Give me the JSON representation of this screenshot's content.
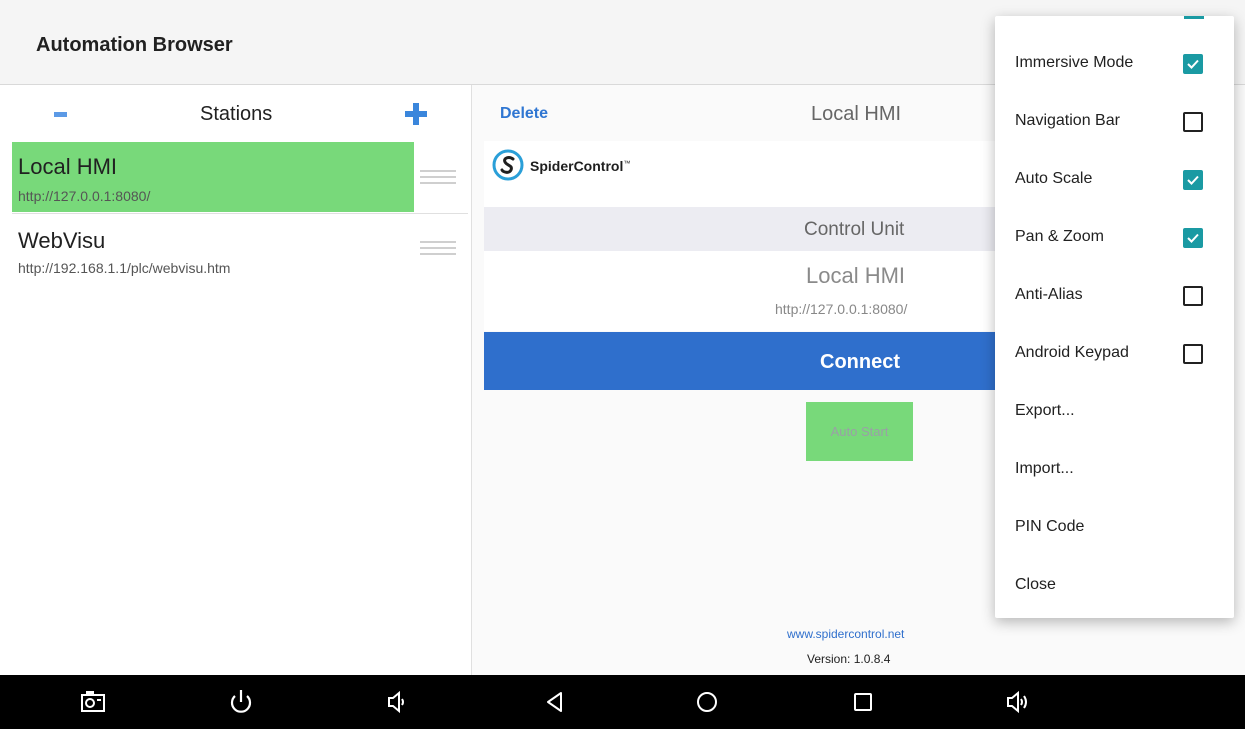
{
  "app": {
    "title": "Automation Browser"
  },
  "stations": {
    "header": {
      "title": "Stations",
      "minus_icon": "minus-icon",
      "plus_icon": "plus-icon"
    },
    "items": [
      {
        "name": "Local HMI",
        "url": "http://127.0.0.1:8080/",
        "selected": true
      },
      {
        "name": "WebVisu",
        "url": "http://192.168.1.1/plc/webvisu.htm",
        "selected": false
      }
    ]
  },
  "detail": {
    "delete_label": "Delete",
    "title": "Local HMI",
    "logo_text": "SpiderControl",
    "logo_tm": "™",
    "control_unit_label": "Control Unit",
    "hmi_name": "Local HMI",
    "hmi_url": "http://127.0.0.1:8080/",
    "connect_label": "Connect",
    "auto_start_label": "Auto Start",
    "website": "www.spidercontrol.net",
    "version": "Version: 1.0.8.4"
  },
  "menu": {
    "items": [
      {
        "label": "Immersive Mode",
        "checkbox": true,
        "checked": true
      },
      {
        "label": "Navigation Bar",
        "checkbox": true,
        "checked": false
      },
      {
        "label": "Auto Scale",
        "checkbox": true,
        "checked": true
      },
      {
        "label": "Pan & Zoom",
        "checkbox": true,
        "checked": true
      },
      {
        "label": "Anti-Alias",
        "checkbox": true,
        "checked": false
      },
      {
        "label": "Android Keypad",
        "checkbox": true,
        "checked": false
      },
      {
        "label": "Export...",
        "checkbox": false
      },
      {
        "label": "Import...",
        "checkbox": false
      },
      {
        "label": "PIN Code",
        "checkbox": false
      },
      {
        "label": "Close",
        "checkbox": false
      }
    ]
  },
  "navbar": {
    "icons": [
      "screenshot-icon",
      "power-icon",
      "volume-down-icon",
      "back-icon",
      "home-icon",
      "recents-icon",
      "volume-up-icon"
    ]
  },
  "colors": {
    "accent": "#2f6fcc",
    "selection": "#78d97a",
    "checkbox": "#1a9aa3"
  }
}
